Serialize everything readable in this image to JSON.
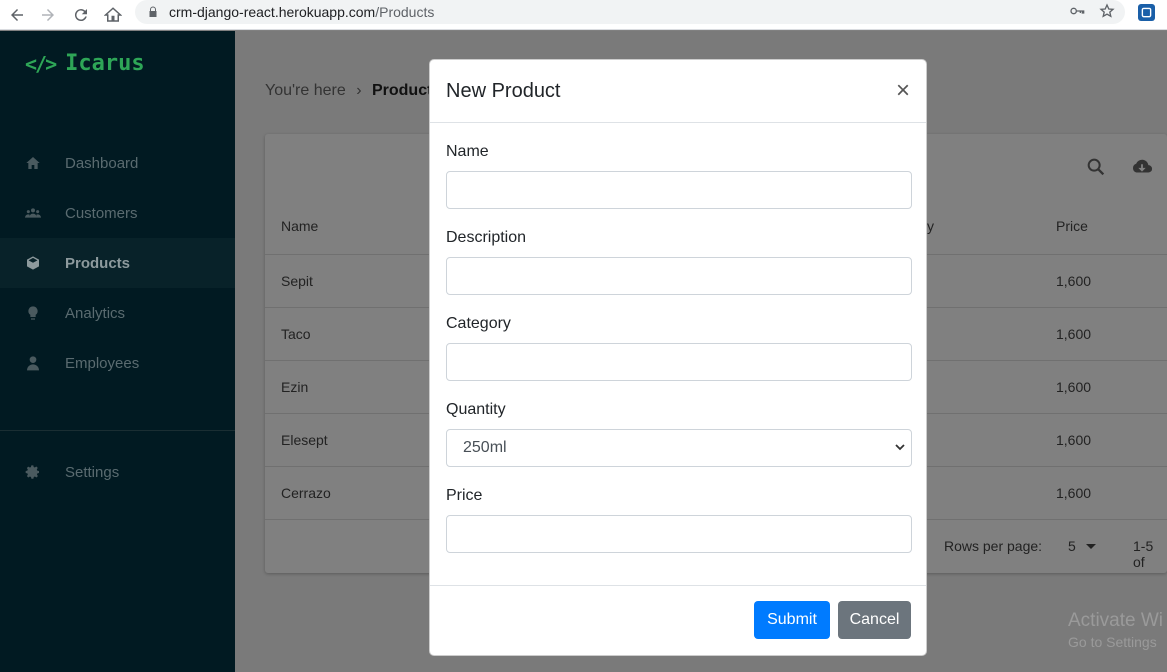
{
  "browser": {
    "url_host": "crm-django-react.herokuapp.com",
    "url_path": "/Products"
  },
  "app": {
    "brand_name": "Icarus",
    "brand_color": "#2ea657",
    "sidebar": {
      "items": [
        {
          "label": "Dashboard",
          "icon": "home-icon",
          "active": false
        },
        {
          "label": "Customers",
          "icon": "users-icon",
          "active": false
        },
        {
          "label": "Products",
          "icon": "cube-icon",
          "active": true
        },
        {
          "label": "Analytics",
          "icon": "lightbulb-icon",
          "active": false
        },
        {
          "label": "Employees",
          "icon": "user-tie-icon",
          "active": false
        }
      ],
      "settings_label": "Settings"
    },
    "breadcrumb": {
      "prefix": "You're here",
      "separator": "›",
      "current": "Product"
    },
    "table": {
      "headers": {
        "name": "Name",
        "quantity": "ity",
        "price": "Price"
      },
      "rows": [
        {
          "name": "Sepit",
          "price": "1,600"
        },
        {
          "name": "Taco",
          "price": "1,600"
        },
        {
          "name": "Ezin",
          "price": "1,600"
        },
        {
          "name": "Elesept",
          "price": "1,600"
        },
        {
          "name": "Cerrazo",
          "price": "1,600"
        }
      ],
      "rows_per_page_label": "Rows per page:",
      "rows_per_page_value": "5",
      "range_text": "1-5 of"
    },
    "watermark": {
      "title": "Activate Wi",
      "subtitle": "Go to Settings"
    }
  },
  "modal": {
    "title": "New Product",
    "close_symbol": "×",
    "fields": {
      "name_label": "Name",
      "name_value": "",
      "description_label": "Description",
      "description_value": "",
      "category_label": "Category",
      "category_value": "",
      "quantity_label": "Quantity",
      "quantity_selected": "250ml",
      "price_label": "Price",
      "price_value": ""
    },
    "submit_label": "Submit",
    "cancel_label": "Cancel",
    "submit_color": "#007bff",
    "cancel_color": "#6c757d"
  }
}
